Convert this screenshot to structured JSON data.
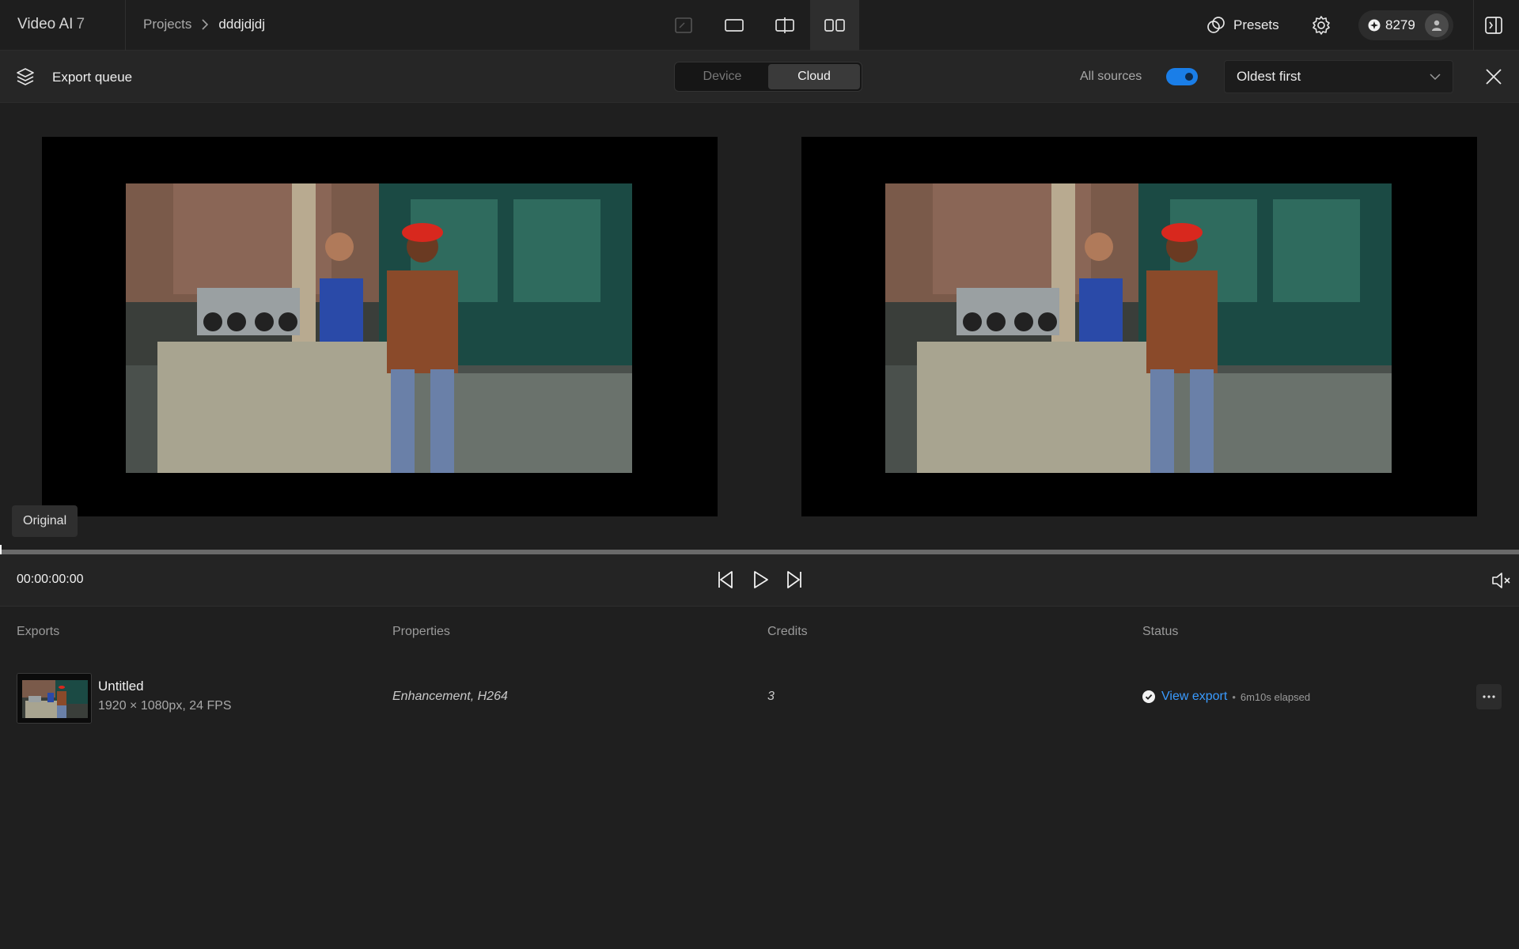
{
  "app": {
    "name": "Video AI",
    "version": "7"
  },
  "breadcrumb": {
    "parent": "Projects",
    "current": "dddjdjdj"
  },
  "view_modes": [
    {
      "icon": "crop-view-icon",
      "active": false
    },
    {
      "icon": "single-view-icon",
      "active": false
    },
    {
      "icon": "split-view-icon",
      "active": false
    },
    {
      "icon": "side-by-side-view-icon",
      "active": true
    }
  ],
  "header": {
    "presets_label": "Presets",
    "credits": "8279"
  },
  "queue": {
    "title": "Export queue",
    "segments": [
      {
        "label": "Device",
        "active": false
      },
      {
        "label": "Cloud",
        "active": true
      }
    ],
    "all_sources_label": "All sources",
    "all_sources_on": true,
    "sort_value": "Oldest first"
  },
  "preview": {
    "original_tag": "Original"
  },
  "transport": {
    "timecode": "00:00:00:00",
    "progress": 0
  },
  "exports": {
    "columns": {
      "exports": "Exports",
      "properties": "Properties",
      "credits": "Credits",
      "status": "Status"
    },
    "rows": [
      {
        "title": "Untitled",
        "meta": "1920 × 1080px, 24 FPS",
        "properties": "Enhancement, H264",
        "credits": "3",
        "status_link": "View export",
        "elapsed": "6m10s elapsed"
      }
    ]
  },
  "colors": {
    "accent": "#1a7ee8",
    "link": "#3a9bff",
    "background": "#1f1f1f"
  }
}
